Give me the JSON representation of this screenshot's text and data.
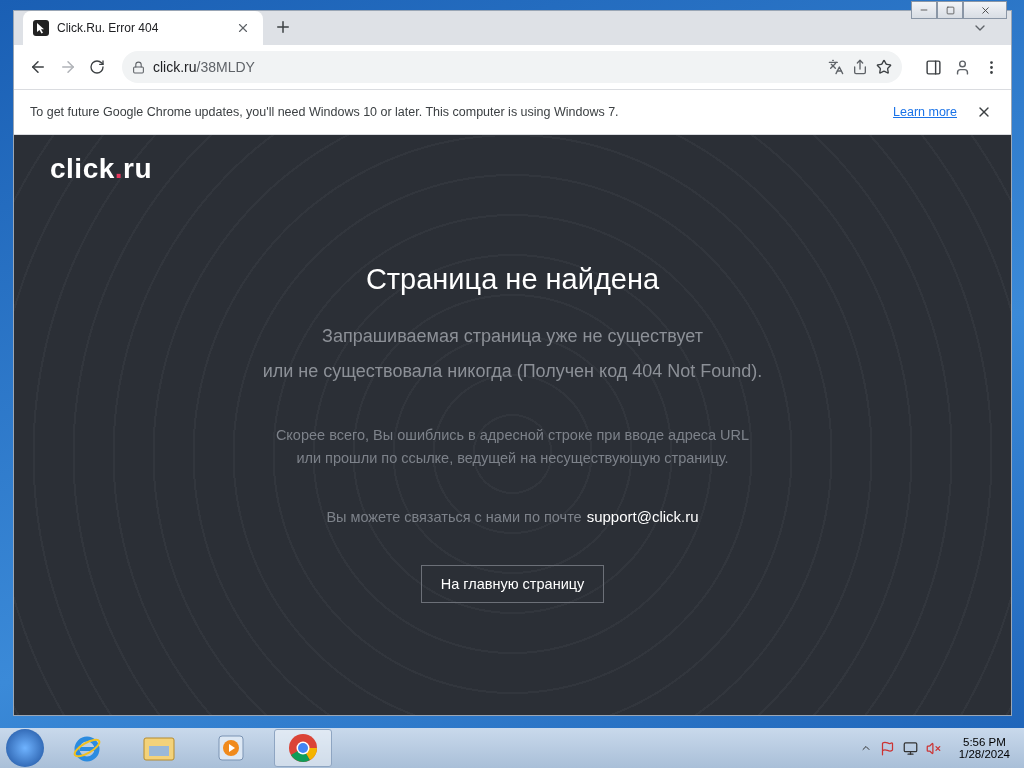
{
  "tabs": [
    {
      "title": "Click.Ru. Error 404",
      "selected": true
    }
  ],
  "toolbar": {
    "url_host": "click.ru",
    "url_path": "/38MLDY"
  },
  "infobar": {
    "message": "To get future Google Chrome updates, you'll need Windows 10 or later. This computer is using Windows 7.",
    "link": "Learn more"
  },
  "page": {
    "logo": {
      "name": "click",
      "dot": ".",
      "tld": "ru"
    },
    "heading": "Страница не найдена",
    "lead_lines": [
      "Запрашиваемая страница уже не существует",
      "или не существовала никогда (Получен код 404 Not Found)."
    ],
    "hint_lines": [
      "Скорее всего, Вы ошиблись в адресной строке при вводе адреса URL",
      "или прошли по ссылке, ведущей на несуществующую страницу."
    ],
    "contact": "Вы можете связаться с нами по почте",
    "email": "support@click.ru",
    "button": "На главную страницу"
  },
  "taskbar": {
    "apps": [
      {
        "kind": "ie",
        "selected": false
      },
      {
        "kind": "explorer",
        "selected": false
      },
      {
        "kind": "media",
        "selected": false
      },
      {
        "kind": "chrome",
        "selected": true
      }
    ],
    "time": "5:56 PM",
    "date": "1/28/2024"
  }
}
